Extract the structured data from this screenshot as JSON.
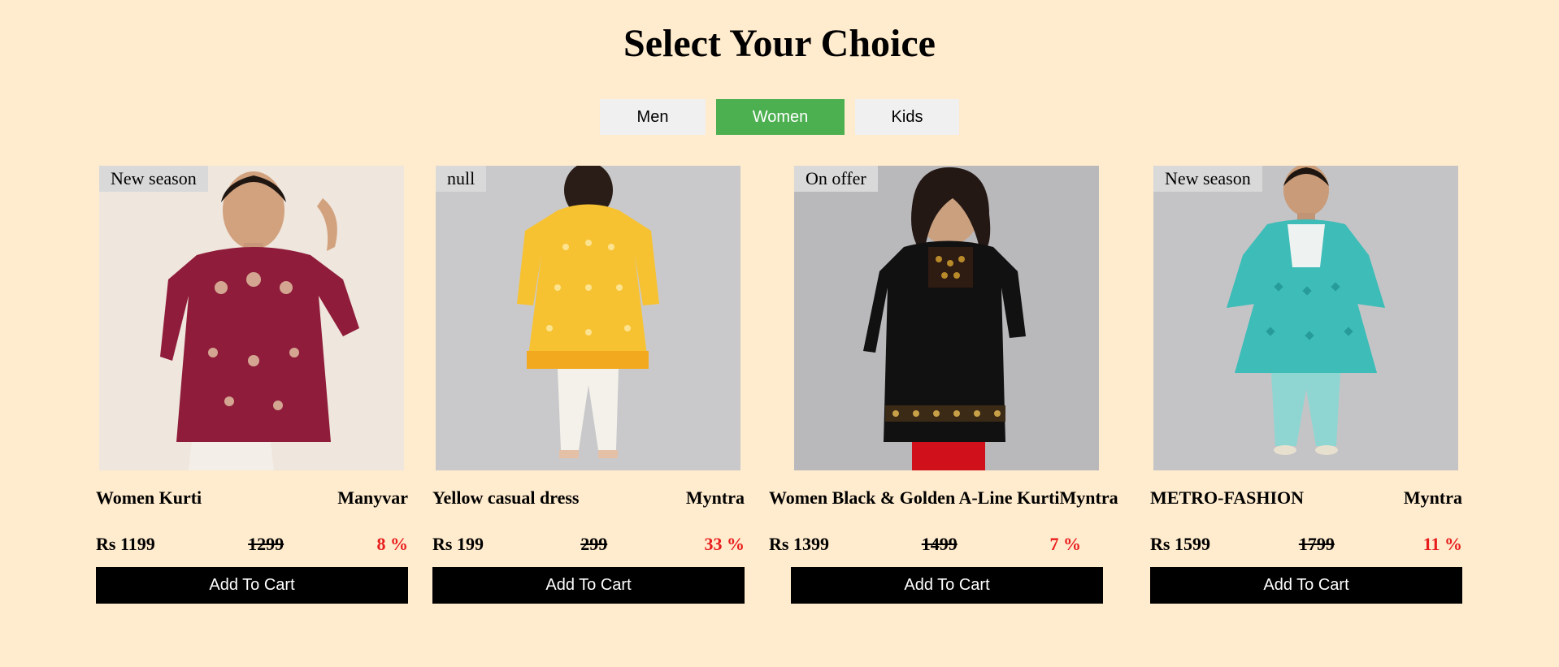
{
  "page": {
    "title": "Select Your Choice"
  },
  "tabs": [
    {
      "label": "Men",
      "active": false
    },
    {
      "label": "Women",
      "active": true
    },
    {
      "label": "Kids",
      "active": false
    }
  ],
  "products": [
    {
      "badge": "New season",
      "name": "Women Kurti",
      "brand": "Manyvar",
      "price": "Rs 1199",
      "old_price": "1299",
      "discount": "8 %",
      "cart_label": "Add To Cart",
      "image": "model-maroon-kurti"
    },
    {
      "badge": "null",
      "name": "Yellow casual dress",
      "brand": "Myntra",
      "price": "Rs 199",
      "old_price": "299",
      "discount": "33 %",
      "cart_label": "Add To Cart",
      "image": "model-yellow-dress"
    },
    {
      "badge": "On offer",
      "name": "Women Black & Golden A-Line Kurti",
      "brand": "Myntra",
      "price": "Rs 1399",
      "old_price": "1499",
      "discount": "7 %",
      "cart_label": "Add To Cart",
      "image": "model-black-kurti"
    },
    {
      "badge": "New season",
      "name": "METRO-FASHION",
      "brand": "Myntra",
      "price": "Rs 1599",
      "old_price": "1799",
      "discount": "11 %",
      "cart_label": "Add To Cart",
      "image": "model-teal-kurta-set"
    }
  ],
  "colors": {
    "background": "#ffebcd",
    "tab_active": "#4caf50",
    "tab_inactive": "#f0f0f0",
    "discount": "#e81c1c",
    "button": "#000000"
  }
}
